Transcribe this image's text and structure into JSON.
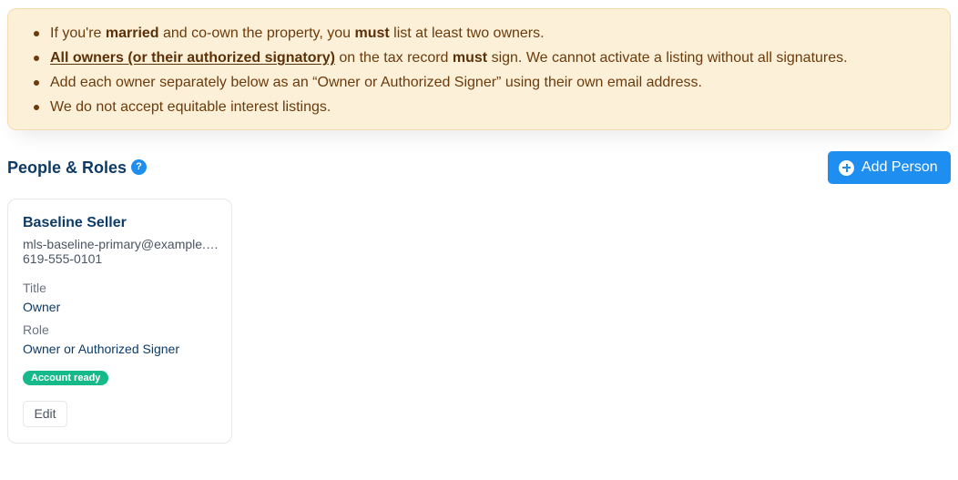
{
  "notice": {
    "items": [
      {
        "parts": [
          "If you're ",
          "married",
          " and co-own the property, you ",
          "must",
          " list at least two owners."
        ]
      },
      {
        "link": "All owners (or their authorized signatory)",
        "parts": [
          " on the tax record ",
          "must",
          " sign. We cannot activate a listing without all signatures."
        ]
      },
      {
        "text": "Add each owner separately below as an “Owner or Authorized Signer” using their own email address."
      },
      {
        "text": "We do not accept equitable interest listings."
      }
    ]
  },
  "section": {
    "title": "People & Roles",
    "help_icon": "?",
    "add_button_label": "Add Person"
  },
  "person": {
    "name": "Baseline Seller",
    "email": "mls-baseline-primary@example.com",
    "phone": "619-555-0101",
    "title_label": "Title",
    "title_value": "Owner",
    "role_label": "Role",
    "role_value": "Owner or Authorized Signer",
    "badge": "Account ready",
    "edit_label": "Edit"
  },
  "colors": {
    "accent": "#1f8ef1",
    "notice_bg": "#fdf0d8",
    "notice_text": "#6b3b0c",
    "badge": "#16b98a",
    "heading": "#0d3b66"
  }
}
